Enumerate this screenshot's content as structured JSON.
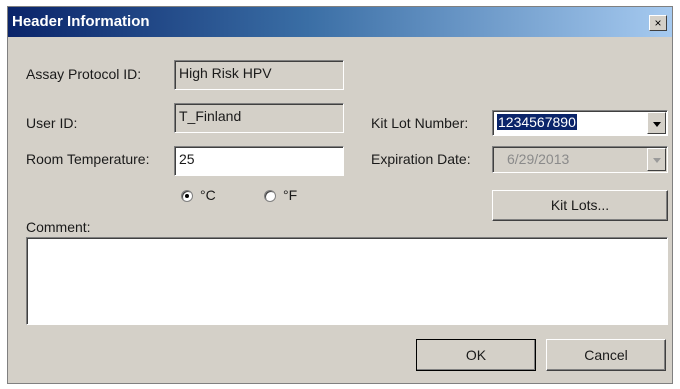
{
  "window": {
    "title": "Header Information",
    "close_glyph": "×"
  },
  "fields": {
    "assay_protocol_id": {
      "label": "Assay Protocol ID:",
      "value": "High Risk HPV"
    },
    "user_id": {
      "label": "User ID:",
      "value": "T_Finland"
    },
    "room_temperature": {
      "label": "Room Temperature:",
      "value": "25"
    },
    "kit_lot_number": {
      "label": "Kit Lot Number:",
      "value": "1234567890"
    },
    "expiration_date": {
      "label": "Expiration Date:",
      "value": "6/29/2013"
    },
    "comment": {
      "label": "Comment:",
      "value": ""
    }
  },
  "temperature_unit": {
    "options": [
      {
        "label": "°C",
        "selected": true
      },
      {
        "label": "°F",
        "selected": false
      }
    ]
  },
  "buttons": {
    "kit_lots": "Kit Lots...",
    "ok": "OK",
    "cancel": "Cancel"
  },
  "icons": {
    "close": "close-icon",
    "dropdown": "chevron-down-icon"
  },
  "colors": {
    "titlebar_start": "#0a246a",
    "titlebar_end": "#a6caf0",
    "dialog_bg": "#d4d0c8",
    "selection": "#0a246a"
  }
}
